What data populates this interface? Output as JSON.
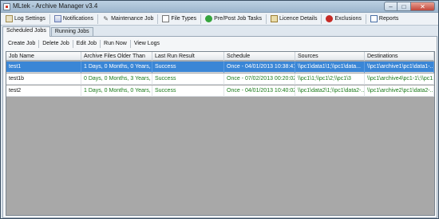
{
  "window": {
    "title": "MLtek - Archive Manager v3.4"
  },
  "menu": [
    {
      "label": "Log Settings",
      "icon": "settings-icon"
    },
    {
      "label": "Notifications",
      "icon": "notifications-icon"
    },
    {
      "label": "Maintenance Job",
      "icon": "wrench-icon"
    },
    {
      "label": "File Types",
      "icon": "file-icon"
    },
    {
      "label": "Pre/Post Job Tasks",
      "icon": "check-circle-icon"
    },
    {
      "label": "Licence Details",
      "icon": "licence-icon"
    },
    {
      "label": "Exclusions",
      "icon": "no-entry-icon"
    },
    {
      "label": "Reports",
      "icon": "reports-icon"
    }
  ],
  "tabs": {
    "scheduled": "Scheduled Jobs",
    "running": "Running Jobs"
  },
  "toolbar": {
    "create": "Create Job",
    "delete": "Delete Job",
    "edit": "Edit Job",
    "run": "Run Now",
    "logs": "View Logs"
  },
  "grid": {
    "columns": [
      "Job Name",
      "Archive Files Older Than",
      "Last Run Result",
      "Schedule",
      "Sources",
      "Destinations"
    ],
    "rows": [
      [
        "test1",
        "1 Days, 0 Months, 0 Years,",
        "Success",
        "Once - 04/01/2013 10:38:41",
        "\\\\pc1\\data1\\1;\\\\pc1\\data...",
        "\\\\pc1\\archive1\\pc1\\data1-..."
      ],
      [
        "test1b",
        "0 Days, 0 Months, 3 Years,",
        "Success",
        "Once - 07/02/2013 00:20:02",
        "\\\\pc1\\1;\\\\pc1\\2;\\\\pc1\\3",
        "\\\\pc1\\archive4\\pc1-1\\;\\\\pc1..."
      ],
      [
        "test2",
        "1 Days, 0 Months, 0 Years,",
        "Success",
        "Once - 04/01/2013 10:40:02",
        "\\\\pc1\\data2\\1;\\\\pc1\\data2-...",
        "\\\\pc1\\archive2\\pc1\\data2-..."
      ]
    ],
    "selected_row": 0
  },
  "colors": {
    "selection": "#3a86d6",
    "success_text": "#1a7a1a",
    "grid_background": "#a8a8a8"
  }
}
